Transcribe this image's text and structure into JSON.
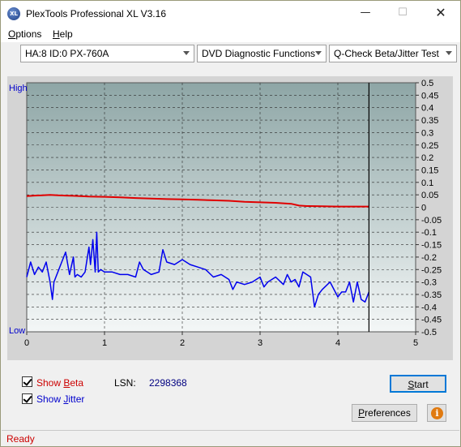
{
  "window": {
    "title": "PlexTools Professional XL V3.16",
    "icon_text": "XL",
    "minimize_icon": "minimize-icon",
    "maximize_icon": "maximize-icon",
    "close_icon": "close-icon"
  },
  "menu": {
    "options_first": "O",
    "options_rest": "ptions",
    "help_first": "H",
    "help_rest": "elp"
  },
  "toolbar": {
    "drive": "HA:8 ID:0  PX-760A",
    "function": "DVD Diagnostic Functions",
    "test": "Q-Check Beta/Jitter Test"
  },
  "chart_data": {
    "type": "line",
    "y_left_high": "High",
    "y_left_low": "Low",
    "xlim": [
      0,
      5
    ],
    "ylim": [
      -0.5,
      0.5
    ],
    "x_ticks": [
      "0",
      "1",
      "2",
      "3",
      "4",
      "5"
    ],
    "y_ticks": [
      "0.5",
      "0.45",
      "0.4",
      "0.35",
      "0.3",
      "0.25",
      "0.2",
      "0.15",
      "0.1",
      "0.05",
      "0",
      "-0.05",
      "-0.1",
      "-0.15",
      "-0.2",
      "-0.25",
      "-0.3",
      "-0.35",
      "-0.4",
      "-0.45",
      "-0.5"
    ],
    "grid": true,
    "end_marker_x": 4.4,
    "series": [
      {
        "color": "#e00000",
        "x": [
          0,
          0.1,
          0.2,
          0.3,
          0.4,
          0.5,
          0.6,
          0.8,
          1.0,
          1.2,
          1.4,
          1.6,
          1.8,
          2.0,
          2.2,
          2.4,
          2.6,
          2.8,
          3.0,
          3.2,
          3.4,
          3.5,
          3.6,
          3.8,
          4.0,
          4.2,
          4.4
        ],
        "values": [
          0.045,
          0.047,
          0.048,
          0.05,
          0.048,
          0.047,
          0.046,
          0.043,
          0.042,
          0.04,
          0.037,
          0.035,
          0.033,
          0.032,
          0.03,
          0.028,
          0.026,
          0.022,
          0.02,
          0.018,
          0.014,
          0.007,
          0.005,
          0.004,
          0.003,
          0.003,
          0.003
        ]
      },
      {
        "color": "#0000ee",
        "x": [
          0,
          0.05,
          0.1,
          0.15,
          0.2,
          0.25,
          0.3,
          0.33,
          0.35,
          0.4,
          0.45,
          0.5,
          0.55,
          0.6,
          0.62,
          0.65,
          0.7,
          0.75,
          0.8,
          0.82,
          0.85,
          0.88,
          0.9,
          0.92,
          0.95,
          1.0,
          1.1,
          1.2,
          1.3,
          1.4,
          1.45,
          1.5,
          1.55,
          1.6,
          1.7,
          1.75,
          1.8,
          1.9,
          2.0,
          2.1,
          2.2,
          2.3,
          2.4,
          2.5,
          2.6,
          2.65,
          2.7,
          2.8,
          2.9,
          3.0,
          3.05,
          3.1,
          3.2,
          3.3,
          3.35,
          3.4,
          3.45,
          3.5,
          3.55,
          3.6,
          3.65,
          3.7,
          3.75,
          3.8,
          3.9,
          4.0,
          4.05,
          4.1,
          4.15,
          4.2,
          4.25,
          4.3,
          4.35,
          4.4
        ],
        "values": [
          -0.28,
          -0.22,
          -0.27,
          -0.24,
          -0.26,
          -0.22,
          -0.3,
          -0.37,
          -0.3,
          -0.26,
          -0.22,
          -0.18,
          -0.27,
          -0.2,
          -0.28,
          -0.27,
          -0.28,
          -0.26,
          -0.16,
          -0.23,
          -0.13,
          -0.26,
          -0.1,
          -0.26,
          -0.25,
          -0.26,
          -0.26,
          -0.27,
          -0.27,
          -0.28,
          -0.22,
          -0.25,
          -0.26,
          -0.27,
          -0.26,
          -0.17,
          -0.22,
          -0.23,
          -0.21,
          -0.23,
          -0.24,
          -0.25,
          -0.28,
          -0.27,
          -0.29,
          -0.33,
          -0.3,
          -0.31,
          -0.3,
          -0.28,
          -0.32,
          -0.3,
          -0.28,
          -0.31,
          -0.27,
          -0.3,
          -0.29,
          -0.32,
          -0.26,
          -0.27,
          -0.28,
          -0.4,
          -0.35,
          -0.33,
          -0.3,
          -0.36,
          -0.34,
          -0.34,
          -0.3,
          -0.38,
          -0.3,
          -0.37,
          -0.38,
          -0.34
        ]
      }
    ]
  },
  "controls": {
    "show_beta_label": "Show ",
    "show_beta_hotkey": "B",
    "show_beta_rest": "eta",
    "show_jitter_label": "Show ",
    "show_jitter_hotkey": "J",
    "show_jitter_rest": "itter",
    "lsn_label": "LSN:",
    "lsn_value": "2298368",
    "start_first": "S",
    "start_rest": "tart",
    "prefs_first": "P",
    "prefs_rest": "references",
    "info_icon": "info-icon"
  },
  "status": {
    "text": "Ready"
  }
}
